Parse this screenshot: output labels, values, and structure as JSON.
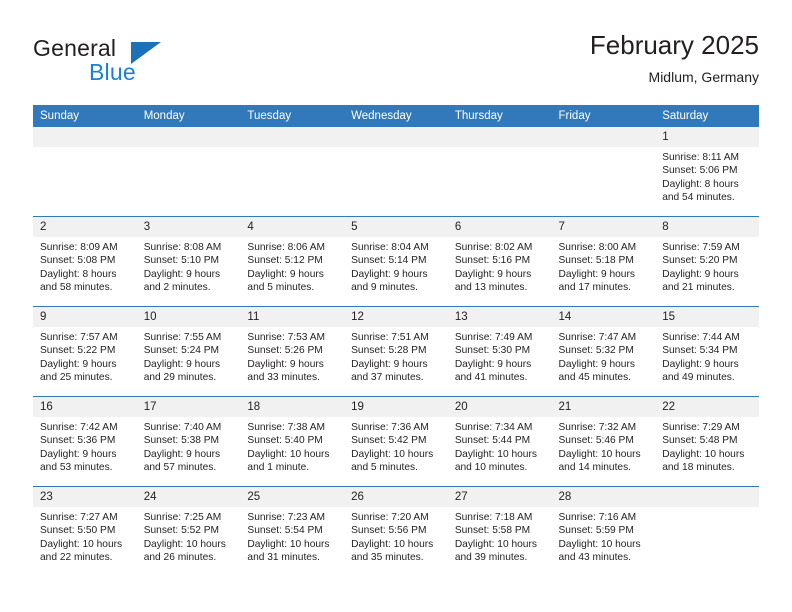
{
  "logo": {
    "word_top": "General",
    "word_bottom": "Blue",
    "triangle_color": "#1b72b8",
    "blue_text_color": "#1b7fd4"
  },
  "header": {
    "title": "February 2025",
    "location": "Midlum, Germany"
  },
  "theme": {
    "header_bg": "#3279bb",
    "daynum_bg": "#f1f1f1",
    "grid_line": "#3279bb",
    "text": "#231f20"
  },
  "columns": [
    "Sunday",
    "Monday",
    "Tuesday",
    "Wednesday",
    "Thursday",
    "Friday",
    "Saturday"
  ],
  "weeks": [
    [
      {
        "day": "",
        "empty": true
      },
      {
        "day": "",
        "empty": true
      },
      {
        "day": "",
        "empty": true
      },
      {
        "day": "",
        "empty": true
      },
      {
        "day": "",
        "empty": true
      },
      {
        "day": "",
        "empty": true
      },
      {
        "day": "1",
        "sunrise": "Sunrise: 8:11 AM",
        "sunset": "Sunset: 5:06 PM",
        "daylight": "Daylight: 8 hours and 54 minutes."
      }
    ],
    [
      {
        "day": "2",
        "sunrise": "Sunrise: 8:09 AM",
        "sunset": "Sunset: 5:08 PM",
        "daylight": "Daylight: 8 hours and 58 minutes."
      },
      {
        "day": "3",
        "sunrise": "Sunrise: 8:08 AM",
        "sunset": "Sunset: 5:10 PM",
        "daylight": "Daylight: 9 hours and 2 minutes."
      },
      {
        "day": "4",
        "sunrise": "Sunrise: 8:06 AM",
        "sunset": "Sunset: 5:12 PM",
        "daylight": "Daylight: 9 hours and 5 minutes."
      },
      {
        "day": "5",
        "sunrise": "Sunrise: 8:04 AM",
        "sunset": "Sunset: 5:14 PM",
        "daylight": "Daylight: 9 hours and 9 minutes."
      },
      {
        "day": "6",
        "sunrise": "Sunrise: 8:02 AM",
        "sunset": "Sunset: 5:16 PM",
        "daylight": "Daylight: 9 hours and 13 minutes."
      },
      {
        "day": "7",
        "sunrise": "Sunrise: 8:00 AM",
        "sunset": "Sunset: 5:18 PM",
        "daylight": "Daylight: 9 hours and 17 minutes."
      },
      {
        "day": "8",
        "sunrise": "Sunrise: 7:59 AM",
        "sunset": "Sunset: 5:20 PM",
        "daylight": "Daylight: 9 hours and 21 minutes."
      }
    ],
    [
      {
        "day": "9",
        "sunrise": "Sunrise: 7:57 AM",
        "sunset": "Sunset: 5:22 PM",
        "daylight": "Daylight: 9 hours and 25 minutes."
      },
      {
        "day": "10",
        "sunrise": "Sunrise: 7:55 AM",
        "sunset": "Sunset: 5:24 PM",
        "daylight": "Daylight: 9 hours and 29 minutes."
      },
      {
        "day": "11",
        "sunrise": "Sunrise: 7:53 AM",
        "sunset": "Sunset: 5:26 PM",
        "daylight": "Daylight: 9 hours and 33 minutes."
      },
      {
        "day": "12",
        "sunrise": "Sunrise: 7:51 AM",
        "sunset": "Sunset: 5:28 PM",
        "daylight": "Daylight: 9 hours and 37 minutes."
      },
      {
        "day": "13",
        "sunrise": "Sunrise: 7:49 AM",
        "sunset": "Sunset: 5:30 PM",
        "daylight": "Daylight: 9 hours and 41 minutes."
      },
      {
        "day": "14",
        "sunrise": "Sunrise: 7:47 AM",
        "sunset": "Sunset: 5:32 PM",
        "daylight": "Daylight: 9 hours and 45 minutes."
      },
      {
        "day": "15",
        "sunrise": "Sunrise: 7:44 AM",
        "sunset": "Sunset: 5:34 PM",
        "daylight": "Daylight: 9 hours and 49 minutes."
      }
    ],
    [
      {
        "day": "16",
        "sunrise": "Sunrise: 7:42 AM",
        "sunset": "Sunset: 5:36 PM",
        "daylight": "Daylight: 9 hours and 53 minutes."
      },
      {
        "day": "17",
        "sunrise": "Sunrise: 7:40 AM",
        "sunset": "Sunset: 5:38 PM",
        "daylight": "Daylight: 9 hours and 57 minutes."
      },
      {
        "day": "18",
        "sunrise": "Sunrise: 7:38 AM",
        "sunset": "Sunset: 5:40 PM",
        "daylight": "Daylight: 10 hours and 1 minute."
      },
      {
        "day": "19",
        "sunrise": "Sunrise: 7:36 AM",
        "sunset": "Sunset: 5:42 PM",
        "daylight": "Daylight: 10 hours and 5 minutes."
      },
      {
        "day": "20",
        "sunrise": "Sunrise: 7:34 AM",
        "sunset": "Sunset: 5:44 PM",
        "daylight": "Daylight: 10 hours and 10 minutes."
      },
      {
        "day": "21",
        "sunrise": "Sunrise: 7:32 AM",
        "sunset": "Sunset: 5:46 PM",
        "daylight": "Daylight: 10 hours and 14 minutes."
      },
      {
        "day": "22",
        "sunrise": "Sunrise: 7:29 AM",
        "sunset": "Sunset: 5:48 PM",
        "daylight": "Daylight: 10 hours and 18 minutes."
      }
    ],
    [
      {
        "day": "23",
        "sunrise": "Sunrise: 7:27 AM",
        "sunset": "Sunset: 5:50 PM",
        "daylight": "Daylight: 10 hours and 22 minutes."
      },
      {
        "day": "24",
        "sunrise": "Sunrise: 7:25 AM",
        "sunset": "Sunset: 5:52 PM",
        "daylight": "Daylight: 10 hours and 26 minutes."
      },
      {
        "day": "25",
        "sunrise": "Sunrise: 7:23 AM",
        "sunset": "Sunset: 5:54 PM",
        "daylight": "Daylight: 10 hours and 31 minutes."
      },
      {
        "day": "26",
        "sunrise": "Sunrise: 7:20 AM",
        "sunset": "Sunset: 5:56 PM",
        "daylight": "Daylight: 10 hours and 35 minutes."
      },
      {
        "day": "27",
        "sunrise": "Sunrise: 7:18 AM",
        "sunset": "Sunset: 5:58 PM",
        "daylight": "Daylight: 10 hours and 39 minutes."
      },
      {
        "day": "28",
        "sunrise": "Sunrise: 7:16 AM",
        "sunset": "Sunset: 5:59 PM",
        "daylight": "Daylight: 10 hours and 43 minutes."
      },
      {
        "day": "",
        "empty": true
      }
    ]
  ]
}
